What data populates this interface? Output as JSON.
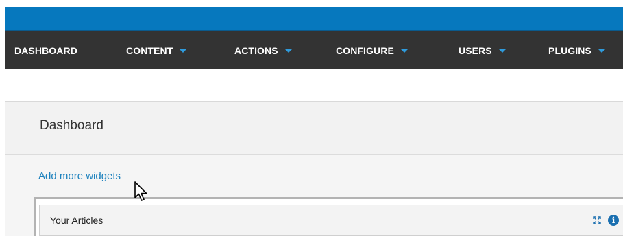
{
  "nav": {
    "items": [
      {
        "label": "DASHBOARD",
        "has_caret": false
      },
      {
        "label": "CONTENT",
        "has_caret": true
      },
      {
        "label": "ACTIONS",
        "has_caret": true
      },
      {
        "label": "CONFIGURE",
        "has_caret": true
      },
      {
        "label": "USERS",
        "has_caret": true
      },
      {
        "label": "PLUGINS",
        "has_caret": true
      }
    ]
  },
  "page": {
    "title": "Dashboard",
    "add_widgets_link": "Add more widgets"
  },
  "widget": {
    "title": "Your Articles",
    "icons": [
      "maximise-icon",
      "info-icon"
    ],
    "info_glyph": "i"
  },
  "colors": {
    "top_bar": "#0678be",
    "nav_bg": "#333333",
    "caret": "#2f9bdc",
    "link": "#1c81bd",
    "info_icon": "#1a6fb0"
  }
}
